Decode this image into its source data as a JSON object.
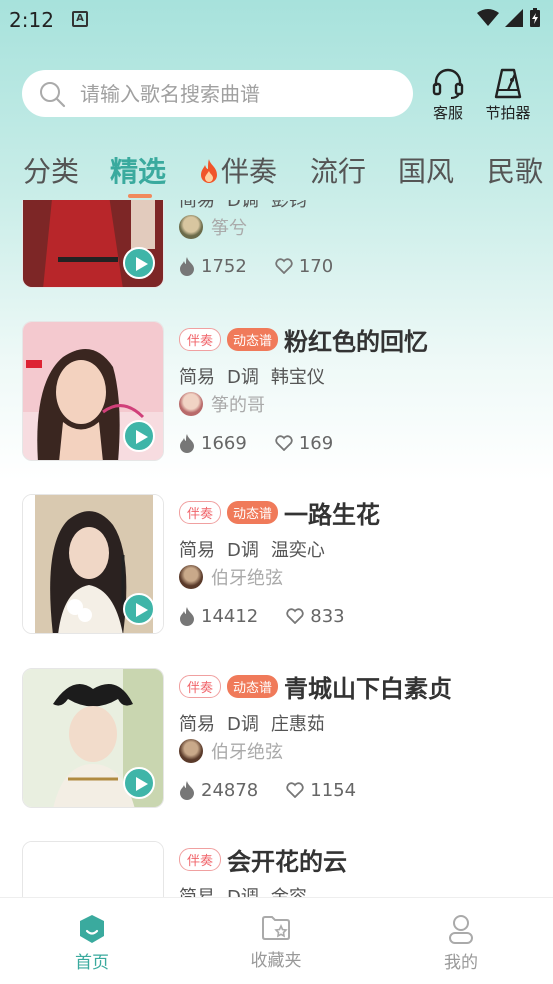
{
  "status": {
    "time": "2:12",
    "notif_letter": "A"
  },
  "search": {
    "placeholder": "请输入歌名搜索曲谱"
  },
  "top_actions": {
    "service_label": "客服",
    "metronome_label": "节拍器"
  },
  "tabs": [
    {
      "label": "分类",
      "active": false
    },
    {
      "label": "精选",
      "active": true
    },
    {
      "label": "伴奏",
      "active": false,
      "hot": true
    },
    {
      "label": "流行",
      "active": false
    },
    {
      "label": "国风",
      "active": false
    },
    {
      "label": "民歌",
      "active": false
    }
  ],
  "songs": [
    {
      "title": "",
      "tags": [],
      "meta": [
        "简易",
        "D调",
        "彭钧"
      ],
      "uploader": "筝兮",
      "plays": "1752",
      "likes": "170"
    },
    {
      "title": "粉红色的回忆",
      "tags": [
        "伴奏",
        "动态谱"
      ],
      "meta": [
        "简易",
        "D调",
        "韩宝仪"
      ],
      "uploader": "筝的哥",
      "plays": "1669",
      "likes": "169"
    },
    {
      "title": "一路生花",
      "tags": [
        "伴奏",
        "动态谱"
      ],
      "meta": [
        "简易",
        "D调",
        "温奕心"
      ],
      "uploader": "伯牙绝弦",
      "plays": "14412",
      "likes": "833"
    },
    {
      "title": "青城山下白素贞",
      "tags": [
        "伴奏",
        "动态谱"
      ],
      "meta": [
        "简易",
        "D调",
        "庄惠茹"
      ],
      "uploader": "伯牙绝弦",
      "plays": "24878",
      "likes": "1154"
    },
    {
      "title": "会开花的云",
      "tags": [
        "伴奏"
      ],
      "meta": [
        "简易",
        "D调",
        "金容"
      ],
      "uploader": "",
      "plays": "",
      "likes": ""
    }
  ],
  "bottom_nav": [
    {
      "label": "首页",
      "active": true
    },
    {
      "label": "收藏夹",
      "active": false
    },
    {
      "label": "我的",
      "active": false
    }
  ],
  "colors": {
    "accent": "#3aaa9e",
    "tag_red": "#f0646a",
    "tag_orange": "#f07a5a"
  }
}
